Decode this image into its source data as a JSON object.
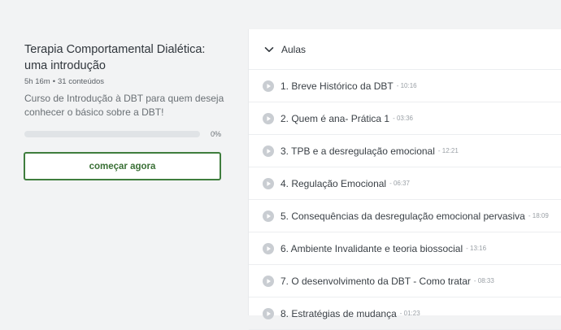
{
  "course": {
    "title": "Terapia Comportamental Dialética: uma introdução",
    "duration": "5h 16m",
    "separator": "•",
    "contents_count": "31 conteúdos",
    "description": "Curso de Introdução à DBT para quem deseja conhecer o básico sobre a DBT!",
    "progress_value": 0,
    "progress_label": "0%",
    "start_button_label": "começar agora",
    "accent_color": "#3f7d3d"
  },
  "section": {
    "label": "Aulas",
    "icon": "chevron-down-icon",
    "expanded": true
  },
  "lessons": [
    {
      "title": "1. Breve Histórico da DBT",
      "duration": "- 10:16"
    },
    {
      "title": "2. Quem é ana- Prática 1",
      "duration": "- 03:36"
    },
    {
      "title": "3. TPB e a desregulação emocional",
      "duration": "- 12:21"
    },
    {
      "title": "4. Regulação Emocional",
      "duration": "- 06:37"
    },
    {
      "title": "5. Consequências da desregulação emocional pervasiva",
      "duration": "- 18:09"
    },
    {
      "title": "6. Ambiente Invalidante e teoria biossocial",
      "duration": "- 13:16"
    },
    {
      "title": "7. O desenvolvimento da DBT - Como tratar",
      "duration": "- 08:33"
    },
    {
      "title": "8. Estratégias de mudança",
      "duration": "- 01:23"
    }
  ],
  "lesson_icon": "play-circle-icon"
}
